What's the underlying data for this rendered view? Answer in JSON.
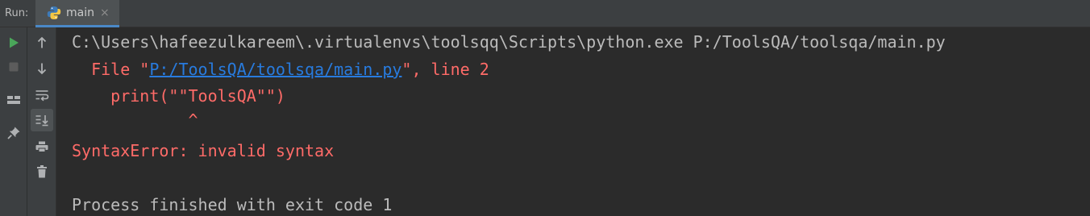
{
  "run_panel": {
    "label": "Run:",
    "tab": {
      "label": "main",
      "close": "×",
      "icon": "python-icon"
    }
  },
  "toolbar": {
    "left": [
      {
        "name": "run-icon",
        "color": "#4aa65a"
      },
      {
        "name": "stop-icon",
        "color": "#5c5c5c"
      },
      {
        "name": "layout-icon",
        "color": "#afb1b3"
      },
      {
        "name": "pin-icon",
        "color": "#afb1b3"
      }
    ],
    "right": [
      {
        "name": "arrow-up-icon"
      },
      {
        "name": "arrow-down-icon"
      },
      {
        "name": "soft-wrap-icon"
      },
      {
        "name": "scroll-to-end-icon"
      },
      {
        "name": "print-icon"
      },
      {
        "name": "trash-icon"
      }
    ]
  },
  "console": {
    "command": "C:\\Users\\hafeezulkareem\\.virtualenvs\\toolsqq\\Scripts\\python.exe P:/ToolsQA/toolsqa/main.py",
    "file_prefix": "  File \"",
    "file_link": "P:/ToolsQA/toolsqa/main.py",
    "file_suffix": "\", line 2",
    "code_line": "    print(\"\"ToolsQA\"\")",
    "caret_line": "            ^",
    "error": "SyntaxError: invalid syntax",
    "exit": "Process finished with exit code 1"
  },
  "colors": {
    "background": "#2b2b2b",
    "toolbar": "#3c3f41",
    "text": "#bbbbbb",
    "error": "#ff6b68",
    "link": "#287bde",
    "run": "#4aa65a",
    "tab_underline": "#4a88c7"
  }
}
